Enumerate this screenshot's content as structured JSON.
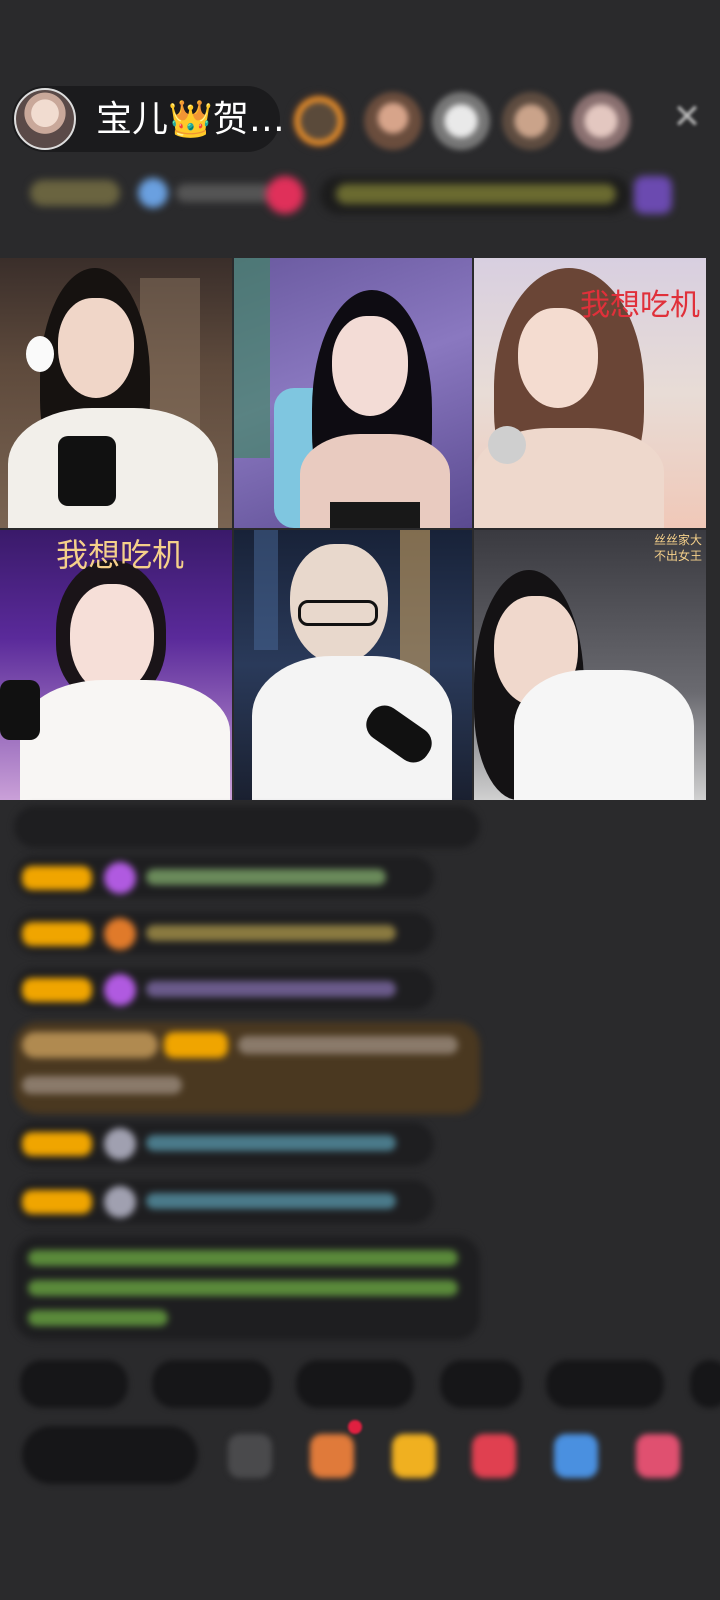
{
  "header": {
    "host_name": "宝儿👑贺…"
  },
  "video_grid": {
    "tiles": [
      {
        "label": ""
      },
      {
        "label": ""
      },
      {
        "label": "我想吃机"
      },
      {
        "label": "我想吃机"
      },
      {
        "label": ""
      },
      {
        "label": "丝丝家大\n不出女王"
      }
    ]
  },
  "colors": {
    "background": "#2a2a2c",
    "label_red": "#e0303a",
    "label_gold": "#f5d08a",
    "badge_orange": "#f0a500",
    "chat_green": "#8bd45a",
    "chat_purple": "#b088f0"
  }
}
